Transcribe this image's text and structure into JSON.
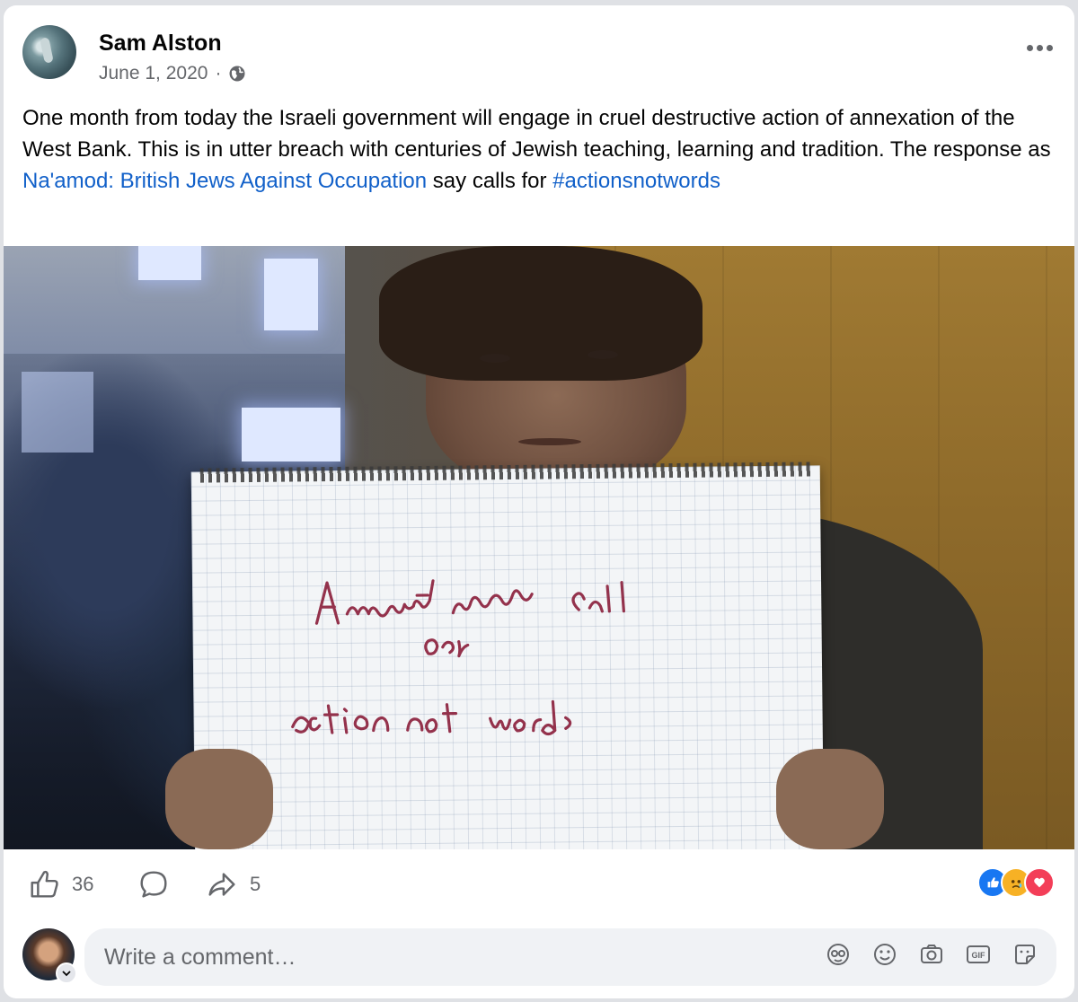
{
  "post": {
    "author": "Sam Alston",
    "date": "June 1, 2020",
    "separator": "·",
    "audience_icon": "globe-icon",
    "text_part1": "One month from today the Israeli government will engage in  cruel destructive action of annexation of the West Bank. This is in utter breach with centuries of Jewish teaching, learning and tradition.  The response as ",
    "link_text": "Na'amod: British Jews Against Occupation",
    "text_part2": " say calls for ",
    "hashtag": "#actionsnotwords",
    "photo": {
      "sign_line1": "Annexation calls",
      "sign_line2": "for",
      "sign_line3": "action not words"
    }
  },
  "actions": {
    "like_count": "36",
    "comment_icon": "comment-icon",
    "share_count": "5",
    "reactions": [
      "like",
      "sad",
      "love"
    ]
  },
  "comment": {
    "placeholder": "Write a comment…",
    "icons": [
      "avatar-sticker-icon",
      "emoji-icon",
      "camera-icon",
      "gif-icon",
      "sticker-icon"
    ]
  },
  "colors": {
    "link": "#1160c9",
    "text": "#050505",
    "secondary": "#65676b",
    "like_blue": "#1877f2",
    "love_red": "#f33e58",
    "sad_yellow": "#f7b125"
  }
}
